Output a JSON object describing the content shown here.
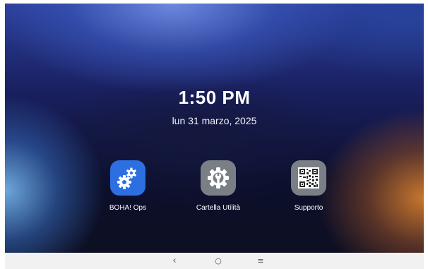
{
  "lockscreen": {
    "time": "1:50 PM",
    "date": "lun 31 marzo, 2025"
  },
  "apps": [
    {
      "label": "BOHA! Ops",
      "icon": "gears-icon",
      "color": "#2d6fe0"
    },
    {
      "label": "Cartella Utilità",
      "icon": "settings-wrench-icon",
      "color": "#7a7f86"
    },
    {
      "label": "Supporto",
      "icon": "qr-code-icon",
      "color": "#7a7f86"
    }
  ],
  "navbar": {
    "back": "‹",
    "home": "○",
    "recents": "≡"
  }
}
